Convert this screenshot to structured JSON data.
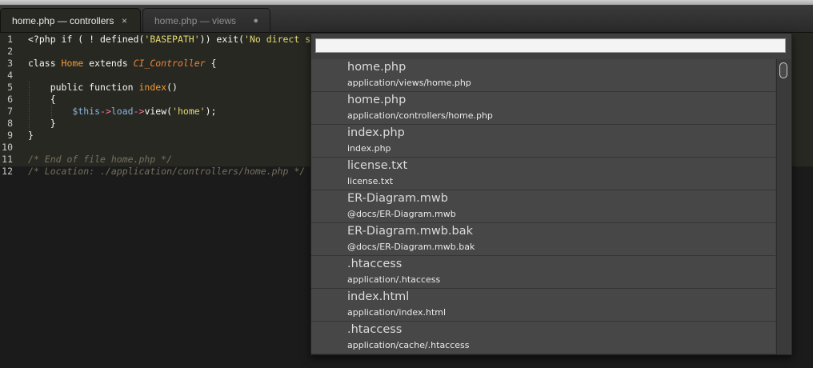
{
  "tabs": [
    {
      "label": "home.php — controllers",
      "close_symbol": "×",
      "active": true
    },
    {
      "label": "home.php — views",
      "dirty_symbol": "●",
      "active": false
    }
  ],
  "gutter": [
    "1",
    "2",
    "3",
    "4",
    "5",
    "6",
    "7",
    "8",
    "9",
    "10",
    "11",
    "12"
  ],
  "code": {
    "line1": {
      "a": "<?php if ( ! defined(",
      "b": "'BASEPATH'",
      "c": ")) exit(",
      "d": "'No direct s"
    },
    "line3": {
      "a": "class ",
      "b": "Home",
      "c": " extends ",
      "d": "CI_Controller",
      "e": " {"
    },
    "line5": {
      "a": "    public function ",
      "b": "index",
      "c": "()"
    },
    "line6": {
      "a": "    {"
    },
    "line7": {
      "a": "        ",
      "b": "$this",
      "c": "->",
      "d": "load",
      "e": "->",
      "f": "view(",
      "g": "'home'",
      "h": ");"
    },
    "line8": {
      "a": "    }"
    },
    "line9": {
      "a": "}"
    },
    "line11": {
      "a": "/* End of file home.php */"
    },
    "line12": {
      "a": "/* Location: ./application/controllers/home.php */"
    }
  },
  "goto": {
    "query": "",
    "results": [
      {
        "name": "home.php",
        "path": "application/views/home.php"
      },
      {
        "name": "home.php",
        "path": "application/controllers/home.php"
      },
      {
        "name": "index.php",
        "path": "index.php"
      },
      {
        "name": "license.txt",
        "path": "license.txt"
      },
      {
        "name": "ER-Diagram.mwb",
        "path": "@docs/ER-Diagram.mwb"
      },
      {
        "name": "ER-Diagram.mwb.bak",
        "path": "@docs/ER-Diagram.mwb.bak"
      },
      {
        "name": ".htaccess",
        "path": "application/.htaccess"
      },
      {
        "name": "index.html",
        "path": "application/index.html"
      },
      {
        "name": ".htaccess",
        "path": "application/cache/.htaccess"
      }
    ]
  }
}
